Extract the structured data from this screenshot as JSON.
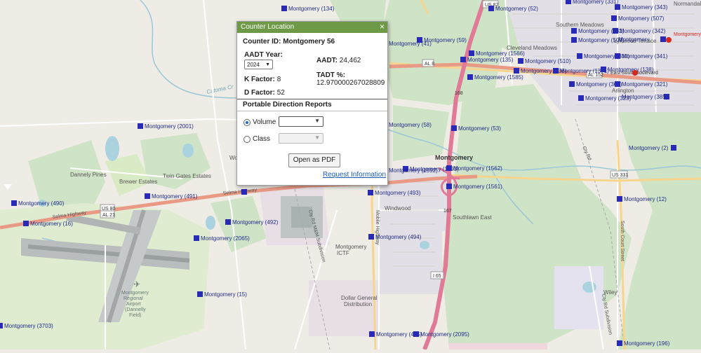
{
  "popup": {
    "title": "Counter Location",
    "close": "×",
    "counter_id": "Counter ID: Montgomery 56",
    "aadt_year_label": "AADT Year:",
    "aadt_year_value": "2024",
    "aadt_label": "AADT:",
    "aadt_value": "24,462",
    "k_label": "K Factor:",
    "k_value": "8",
    "tadt_label": "TADT %:",
    "tadt_value": "12.970000267028809",
    "d_label": "D Factor:",
    "d_value": "52",
    "section_title": "Portable Direction Reports",
    "volume_label": "Volume",
    "class_label": "Class",
    "pdf_button": "Open as PDF",
    "request_link": "Request Information"
  },
  "map": {
    "counters": [
      "Montgomery (134)",
      "Montgomery (52)",
      "Montgomery (331)",
      "Montgomery (343)",
      "Montgomery (507)",
      "Montgomery (342)",
      "Montgomery (332)",
      "Montgomery (509)",
      "Montgomery (333)",
      "Montgomery (341)",
      "Montgomery (510)",
      "Montgomery (1371)",
      "Montgomery (138)",
      "Montgomery (368)",
      "Montgomery (321)",
      "Montgomery (323)",
      "Montgomery (385)",
      "Montgomery (59)",
      "Montgomery (41)",
      "Montgomery (1566)",
      "Montgomery (135)",
      "Montgomery (136)",
      "Montgomery (2001)",
      "Montgomery (58)",
      "Montgomery (53)",
      "Montgomery (491)",
      "Montgomery (490)",
      "Montgomery (1593)",
      "Montgomery (1592)",
      "Montgomery (1562)",
      "Montgomery (1561)",
      "Montgomery (493)",
      "Montgomery (2065)",
      "Montgomery (492)",
      "Montgomery (494)",
      "Montgomery (15)",
      "Montgomery (12)",
      "Montgomery (3703)",
      "Montgomery (495)",
      "Montgomery (2095)",
      "Montgomery (196)",
      "Montgomery (16)",
      "Montgomery (1585)",
      "Montgomery (2)",
      "Montgomery"
    ],
    "places": [
      "Montgomery",
      "Southern Meadows",
      "Cleveland Meadows",
      "Lynwood Terrace",
      "Arlington",
      "Dannely Pines",
      "Brewer Estates",
      "Twin Gates Estates",
      "Windwood",
      "Southlawn East",
      "Montgomery ICTF",
      "Dollar General Distribution",
      "Montgomery Regional Airport (Dannelly Field)",
      "Normandale",
      "Wiley"
    ],
    "roads": [
      "US 82",
      "US 80",
      "AL 21",
      "US 331",
      "I 65",
      "AL 8",
      "AL 152",
      "167",
      "168",
      "Selma Highway",
      "East South Boulevard",
      "Mobile Highway",
      "South Court Street",
      "Eastern Boulevard",
      "Catoma Creek",
      "Cty Rd M&M Subdivision"
    ],
    "accent_counter": "#2a2ab8",
    "accent_selected": "#d42b1f"
  }
}
